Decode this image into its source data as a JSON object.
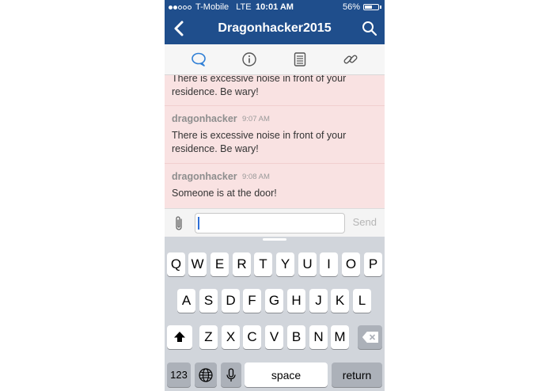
{
  "status_bar": {
    "carrier": "T-Mobile",
    "network": "LTE",
    "time": "10:01 AM",
    "battery_percent": "56%",
    "battery_level": 0.56,
    "signal_bars_filled": 2,
    "signal_bars_total": 5
  },
  "header": {
    "title": "Dragonhacker2015",
    "back_icon": "chevron-left-icon",
    "search_icon": "search-icon",
    "background_color": "#1f4e8c"
  },
  "tabs": [
    {
      "icon": "chat-bubble-icon",
      "active": true
    },
    {
      "icon": "info-icon",
      "active": false
    },
    {
      "icon": "document-icon",
      "active": false
    },
    {
      "icon": "link-icon",
      "active": false
    }
  ],
  "messages": [
    {
      "sender": "",
      "time": "",
      "text": "There is excessive noise in front of your residence. Be wary!"
    },
    {
      "sender": "dragonhacker",
      "time": "9:07 AM",
      "text": "There is excessive noise in front of your residence. Be wary!"
    },
    {
      "sender": "dragonhacker",
      "time": "9:08 AM",
      "text": "Someone is at the door!"
    }
  ],
  "composer": {
    "value": "",
    "placeholder": "",
    "send_label": "Send",
    "attach_icon": "paperclip-icon"
  },
  "keyboard": {
    "row1": [
      "Q",
      "W",
      "E",
      "R",
      "T",
      "Y",
      "U",
      "I",
      "O",
      "P"
    ],
    "row2": [
      "A",
      "S",
      "D",
      "F",
      "G",
      "H",
      "J",
      "K",
      "L"
    ],
    "row3": [
      "Z",
      "X",
      "C",
      "V",
      "B",
      "N",
      "M"
    ],
    "numbers_label": "123",
    "space_label": "space",
    "return_label": "return",
    "shift_icon": "shift-icon",
    "delete_icon": "backspace-icon",
    "globe_icon": "globe-icon",
    "mic_icon": "microphone-icon"
  }
}
